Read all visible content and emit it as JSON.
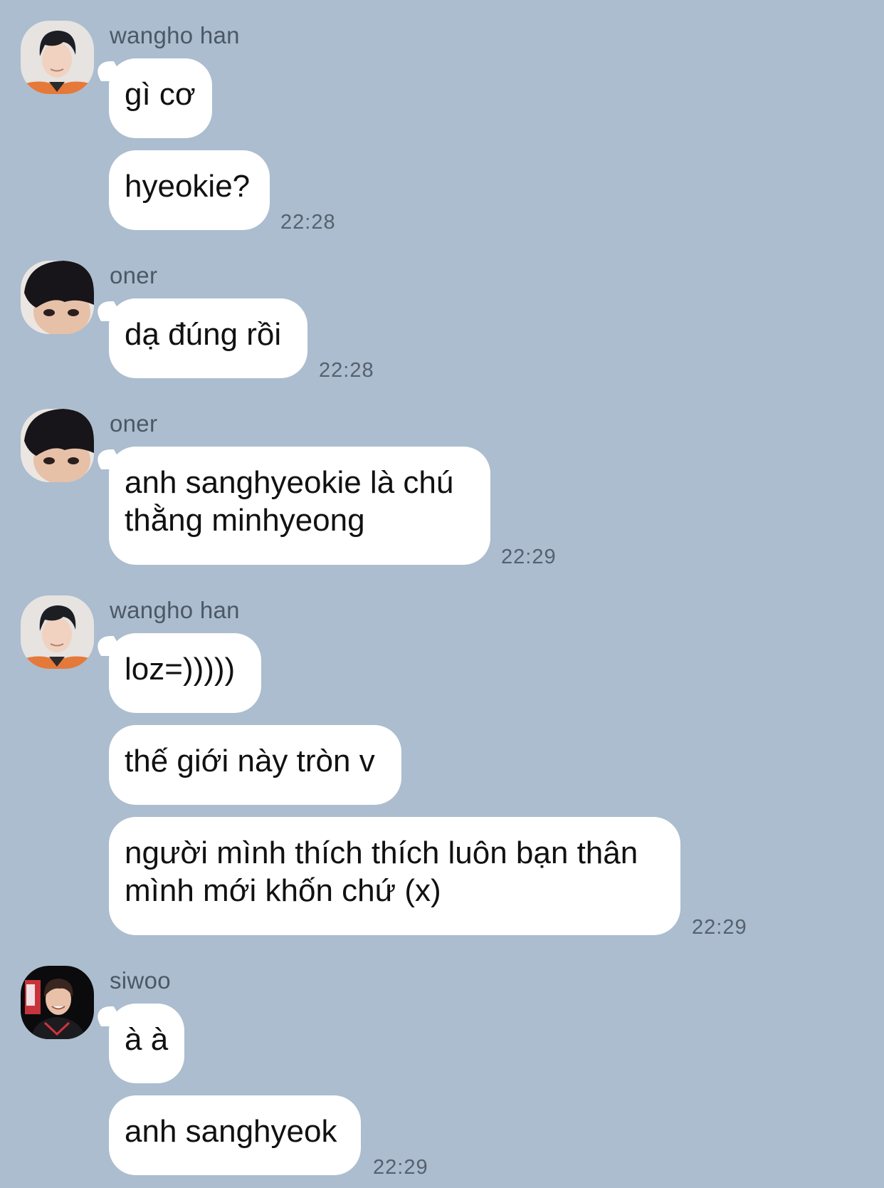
{
  "chat": {
    "groups": [
      {
        "sender": "wangho han",
        "avatar_icon": "profile-photo-wangho-han",
        "messages": [
          "gì cơ",
          "hyeokie?"
        ],
        "time": "22:28"
      },
      {
        "sender": "oner",
        "avatar_icon": "profile-photo-oner",
        "messages": [
          "dạ đúng rồi"
        ],
        "time": "22:28"
      },
      {
        "sender": "oner",
        "avatar_icon": "profile-photo-oner",
        "messages": [
          "anh sanghyeokie là chú\nthằng minhyeong"
        ],
        "time": "22:29"
      },
      {
        "sender": "wangho han",
        "avatar_icon": "profile-photo-wangho-han",
        "messages": [
          "loz=)))))",
          "thế giới này tròn v",
          "người mình thích thích luôn bạn thân\nmình mới khốn chứ (x)"
        ],
        "time": "22:29"
      },
      {
        "sender": "siwoo",
        "avatar_icon": "profile-photo-siwoo",
        "messages": [
          "à à",
          "anh sanghyeok"
        ],
        "time": "22:29"
      }
    ]
  }
}
